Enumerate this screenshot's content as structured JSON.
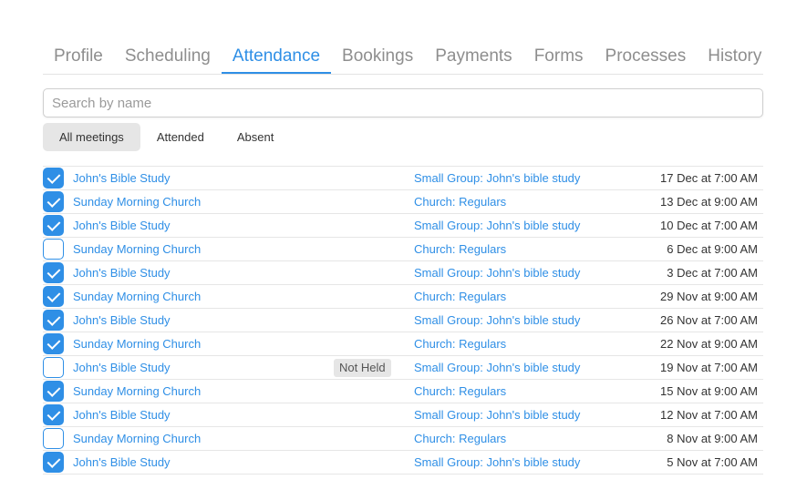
{
  "tabs": [
    {
      "label": "Profile"
    },
    {
      "label": "Scheduling"
    },
    {
      "label": "Attendance",
      "active": true
    },
    {
      "label": "Bookings"
    },
    {
      "label": "Payments"
    },
    {
      "label": "Forms"
    },
    {
      "label": "Processes"
    },
    {
      "label": "History"
    }
  ],
  "search": {
    "placeholder": "Search by name",
    "value": ""
  },
  "filters": [
    {
      "label": "All meetings",
      "active": true
    },
    {
      "label": "Attended"
    },
    {
      "label": "Absent"
    }
  ],
  "accent_color": "#2f8fe6",
  "rows": [
    {
      "checked": true,
      "meeting": "John's Bible Study",
      "badge": "",
      "group": "Small Group: John's bible study",
      "date": "17 Dec at 7:00 AM"
    },
    {
      "checked": true,
      "meeting": "Sunday Morning Church",
      "badge": "",
      "group": "Church: Regulars",
      "date": "13 Dec at 9:00 AM"
    },
    {
      "checked": true,
      "meeting": "John's Bible Study",
      "badge": "",
      "group": "Small Group: John's bible study",
      "date": "10 Dec at 7:00 AM"
    },
    {
      "checked": false,
      "meeting": "Sunday Morning Church",
      "badge": "",
      "group": "Church: Regulars",
      "date": "6 Dec at 9:00 AM"
    },
    {
      "checked": true,
      "meeting": "John's Bible Study",
      "badge": "",
      "group": "Small Group: John's bible study",
      "date": "3 Dec at 7:00 AM"
    },
    {
      "checked": true,
      "meeting": "Sunday Morning Church",
      "badge": "",
      "group": "Church: Regulars",
      "date": "29 Nov at 9:00 AM"
    },
    {
      "checked": true,
      "meeting": "John's Bible Study",
      "badge": "",
      "group": "Small Group: John's bible study",
      "date": "26 Nov at 7:00 AM"
    },
    {
      "checked": true,
      "meeting": "Sunday Morning Church",
      "badge": "",
      "group": "Church: Regulars",
      "date": "22 Nov at 9:00 AM"
    },
    {
      "checked": false,
      "meeting": "John's Bible Study",
      "badge": "Not Held",
      "group": "Small Group: John's bible study",
      "date": "19 Nov at 7:00 AM"
    },
    {
      "checked": true,
      "meeting": "Sunday Morning Church",
      "badge": "",
      "group": "Church: Regulars",
      "date": "15 Nov at 9:00 AM"
    },
    {
      "checked": true,
      "meeting": "John's Bible Study",
      "badge": "",
      "group": "Small Group: John's bible study",
      "date": "12 Nov at 7:00 AM"
    },
    {
      "checked": false,
      "meeting": "Sunday Morning Church",
      "badge": "",
      "group": "Church: Regulars",
      "date": "8 Nov at 9:00 AM"
    },
    {
      "checked": true,
      "meeting": "John's Bible Study",
      "badge": "",
      "group": "Small Group: John's bible study",
      "date": "5 Nov at 7:00 AM"
    }
  ]
}
